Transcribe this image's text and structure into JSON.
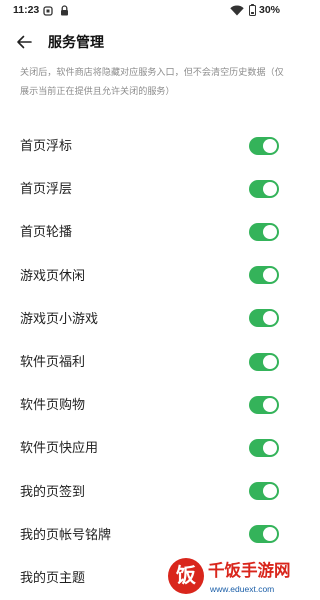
{
  "status": {
    "time": "11:23",
    "battery_text": "30%",
    "battery_level": 0.3
  },
  "header": {
    "title": "服务管理"
  },
  "description": "关闭后，软件商店将隐藏对应服务入口，但不会清空历史数据（仅展示当前正在提供且允许关闭的服务）",
  "theme": {
    "toggle_on_color": "#34b35a"
  },
  "list": {
    "items": [
      {
        "label": "首页浮标",
        "enabled": true
      },
      {
        "label": "首页浮层",
        "enabled": true
      },
      {
        "label": "首页轮播",
        "enabled": true
      },
      {
        "label": "游戏页休闲",
        "enabled": true
      },
      {
        "label": "游戏页小游戏",
        "enabled": true
      },
      {
        "label": "软件页福利",
        "enabled": true
      },
      {
        "label": "软件页购物",
        "enabled": true
      },
      {
        "label": "软件页快应用",
        "enabled": true
      },
      {
        "label": "我的页签到",
        "enabled": true
      },
      {
        "label": "我的页帐号铭牌",
        "enabled": true
      },
      {
        "label": "我的页主题",
        "enabled": true
      }
    ]
  },
  "watermark": {
    "logo_char": "饭",
    "brand": "千饭手游网",
    "url": "www.eduext.com"
  }
}
